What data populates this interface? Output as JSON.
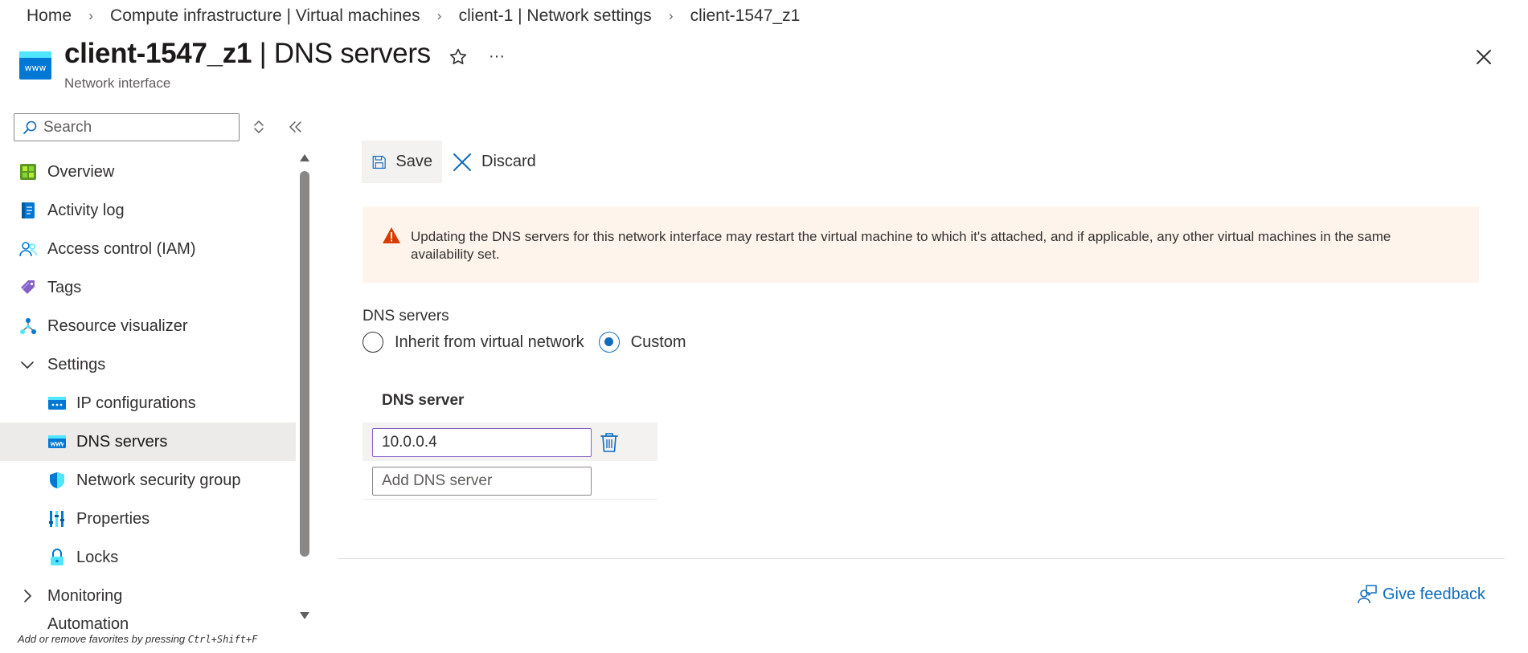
{
  "breadcrumb": [
    {
      "label": "Home"
    },
    {
      "label": "Compute infrastructure | Virtual machines"
    },
    {
      "label": "client-1 | Network settings"
    },
    {
      "label": "client-1547_z1"
    }
  ],
  "header": {
    "resource_name": "client-1547_z1",
    "page_title": " | DNS servers",
    "subtitle": "Network interface",
    "more_label": "···",
    "icon_text": "www"
  },
  "sidebar": {
    "search_placeholder": "Search",
    "items": [
      {
        "label": "Overview"
      },
      {
        "label": "Activity log"
      },
      {
        "label": "Access control (IAM)"
      },
      {
        "label": "Tags"
      },
      {
        "label": "Resource visualizer"
      },
      {
        "label": "Settings"
      },
      {
        "label": "IP configurations"
      },
      {
        "label": "DNS servers"
      },
      {
        "label": "Network security group"
      },
      {
        "label": "Properties"
      },
      {
        "label": "Locks"
      },
      {
        "label": "Monitoring"
      },
      {
        "label": "Automation"
      }
    ],
    "footer_hint_prefix": "Add or remove favorites by pressing ",
    "footer_hint_keys": "Ctrl+Shift+F"
  },
  "toolbar": {
    "save_label": "Save",
    "discard_label": "Discard"
  },
  "warning": {
    "text": "Updating the DNS servers for this network interface may restart the virtual machine to which it's attached, and if applicable, any other virtual machines in the same availability set."
  },
  "dns": {
    "section_label": "DNS servers",
    "options": [
      {
        "label": "Inherit from virtual network",
        "checked": false
      },
      {
        "label": "Custom",
        "checked": true
      }
    ],
    "column_header": "DNS server",
    "entries": [
      "10.0.0.4"
    ],
    "add_placeholder": "Add DNS server"
  },
  "footer": {
    "feedback_label": "Give feedback"
  },
  "colors": {
    "accent": "#0f6cbd",
    "warning_bg": "#fff4ec",
    "warning_icon": "#d83b01",
    "selected_bg": "#edebe9",
    "focus_border": "#8661c5"
  }
}
